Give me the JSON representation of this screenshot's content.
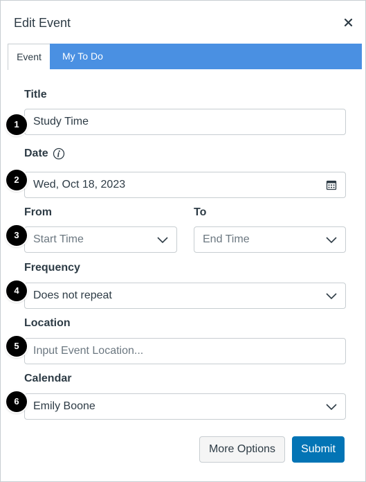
{
  "dialog": {
    "title": "Edit Event",
    "close_symbol": "×"
  },
  "tabs": [
    {
      "label": "Event",
      "selected": true
    },
    {
      "label": "My To Do",
      "selected": false
    }
  ],
  "form": {
    "title": {
      "label": "Title",
      "value": "Study Time",
      "badge": "1"
    },
    "date": {
      "label": "Date",
      "value": "Wed, Oct 18, 2023",
      "badge": "2",
      "info_icon": "info-icon",
      "picker_icon": "calendar-icon"
    },
    "from": {
      "label": "From",
      "placeholder": "Start Time",
      "badge": "3"
    },
    "to": {
      "label": "To",
      "placeholder": "End Time"
    },
    "frequency": {
      "label": "Frequency",
      "value": "Does not repeat",
      "badge": "4"
    },
    "location": {
      "label": "Location",
      "placeholder": "Input Event Location...",
      "badge": "5"
    },
    "calendar": {
      "label": "Calendar",
      "value": "Emily Boone",
      "badge": "6"
    }
  },
  "actions": {
    "more_options": "More Options",
    "submit": "Submit"
  },
  "colors": {
    "tab_bar": "#4a90e2",
    "submit": "#0374b5",
    "border": "#c7cdd1",
    "text": "#2d3b45"
  }
}
